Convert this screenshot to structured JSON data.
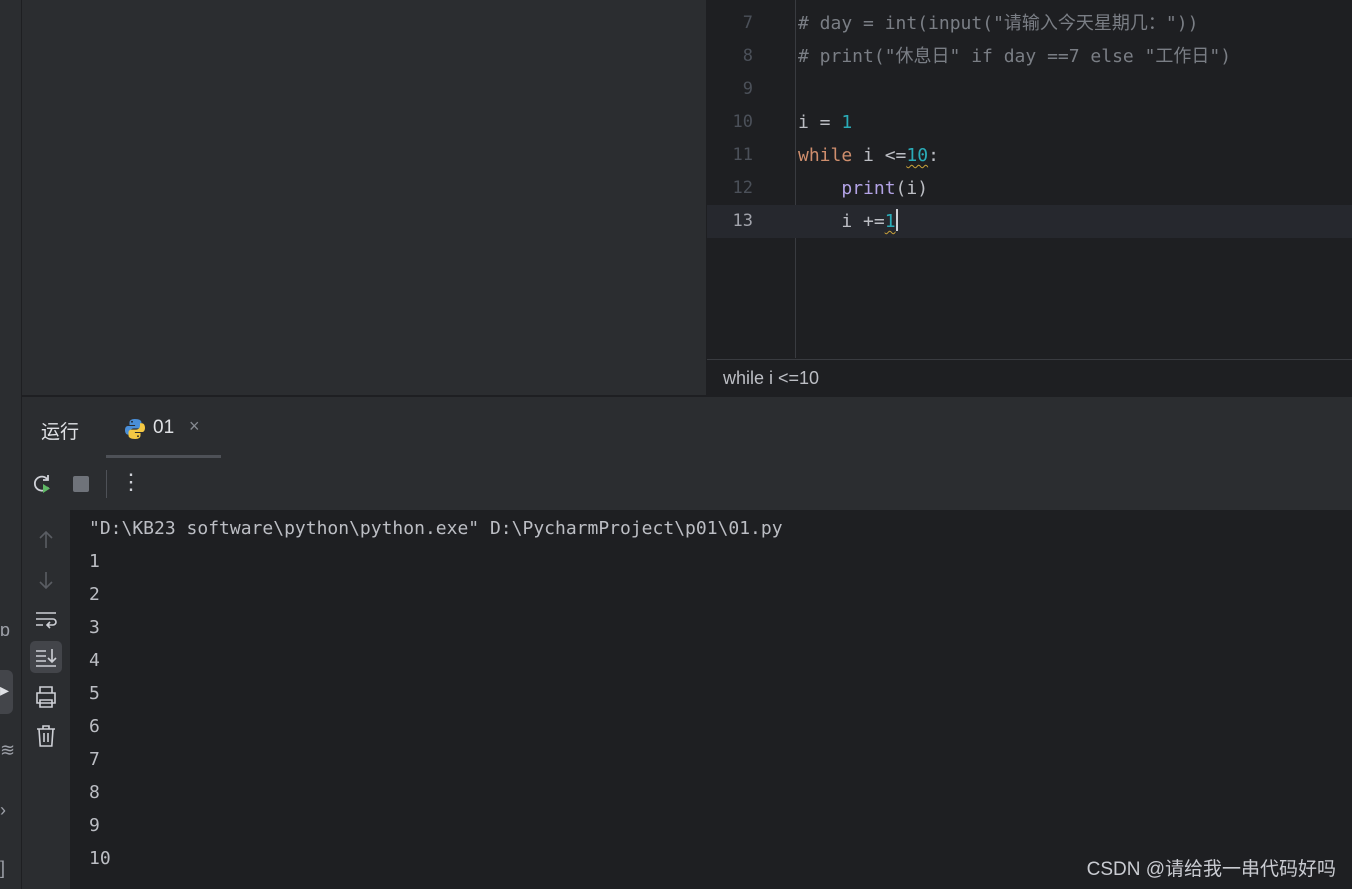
{
  "editor": {
    "lines": [
      {
        "num": "7",
        "code": "# day = int(input(\"请输入今天星期几：\"))"
      },
      {
        "num": "8",
        "code": "# print(\"休息日\" if day ==7 else \"工作日\")"
      },
      {
        "num": "9",
        "code": ""
      },
      {
        "num": "10",
        "code": "i = 1"
      },
      {
        "num": "11",
        "code": "while i <=10:"
      },
      {
        "num": "12",
        "code": "    print(i)"
      },
      {
        "num": "13",
        "code": "    i +=1"
      }
    ],
    "breadcrumb": "while i <=10"
  },
  "run_panel": {
    "title": "运行",
    "tab_label": "01",
    "close_glyph": "×",
    "more_glyph": "⋮"
  },
  "console": {
    "command": "\"D:\\KB23 software\\python\\python.exe\" D:\\PycharmProject\\p01\\01.py",
    "output": [
      "1",
      "2",
      "3",
      "4",
      "5",
      "6",
      "7",
      "8",
      "9",
      "10"
    ]
  },
  "watermark": "CSDN @请给我一串代码好吗",
  "colors": {
    "background": "#1e1f22",
    "panel": "#2b2d30",
    "keyword": "#cf8e6d",
    "number": "#2aacb8",
    "builtin": "#b3a3e6",
    "comment": "#7a7e85",
    "rerun_green": "#5fb865"
  },
  "icons": [
    "rerun-icon",
    "stop-icon",
    "more-icon",
    "up-arrow-icon",
    "down-arrow-icon",
    "soft-wrap-icon",
    "scroll-to-end-icon",
    "print-icon",
    "trash-icon",
    "python-icon",
    "close-icon"
  ]
}
